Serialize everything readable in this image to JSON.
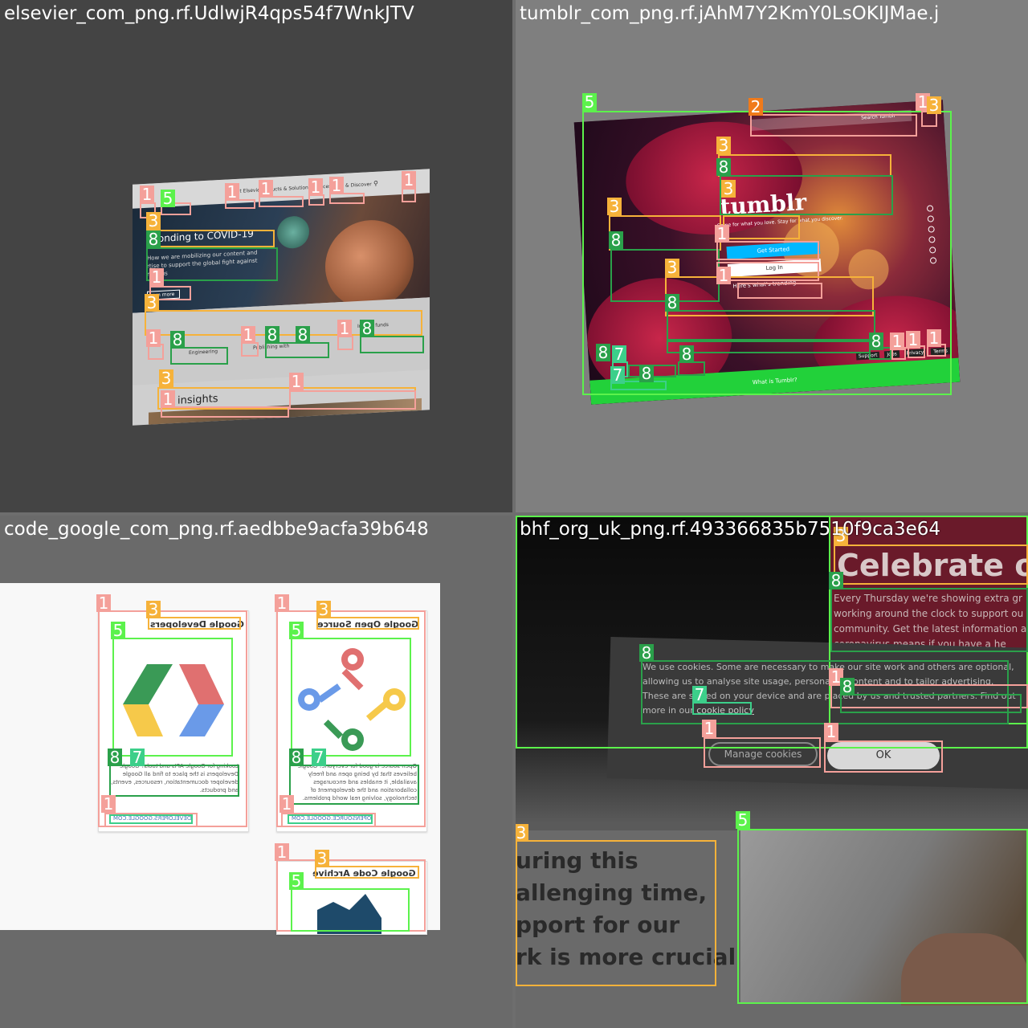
{
  "panels": {
    "q1": {
      "title": "elsevier_com_png.rf.UdlwjR4qps54f7WnkJTV",
      "nav": [
        "About Elsevier",
        "Products & Solutions",
        "Services",
        "Shop & Discover"
      ],
      "hero_heading": "sponding to COVID-19",
      "hero_text": "How we are mobilizing our content and rtise to support the global fight against navirus",
      "hero_button": "arn more",
      "strip_items": [
        "Engineering",
        "Publishing with",
        "Insight funds"
      ],
      "insights": "in insights"
    },
    "q2": {
      "title": "tumblr_com_png.rf.jAhM7Y2KmY0LsOKIJMae.j",
      "search_placeholder": "Search Tumblr",
      "logo": "tumblr",
      "tagline": "Come for what you love. Stay for what you discover.",
      "get_started": "Get Started",
      "log_in": "Log In",
      "trending": "Here's what's trending",
      "footer_links": [
        "Support",
        "Jobs",
        "Privacy",
        "Terms"
      ],
      "footer_bar": "What is Tumblr?"
    },
    "q3": {
      "title": "code_google_com_png.rf.aedbbe9acfa39b648",
      "cards": [
        {
          "title": "Google Developers",
          "desc": "Looking for Google APIs and tools? Google Developers is the place to find all Google developer documentation, resources, events, and products.",
          "link": "DEVELOPERS.GOOGLE.COM"
        },
        {
          "title": "Google Open Source",
          "desc": "Open source is good for everyone! Google believes that by being open and freely available, it enables and encourages collaboration and the development of technology, solving real world problems.",
          "link": "OPENSOURCE.GOOGLE.COM"
        },
        {
          "title": "Google Code Archive",
          "desc": "",
          "link": ""
        }
      ]
    },
    "q4": {
      "title": "bhf_org_uk_png.rf.493366835b7510f9ca3e64",
      "celebrate": "Celebrate ou",
      "side_text": "Every Thursday we're showing extra gr working around the clock to support ou community. Get the latest information a 19 coronavirus means if you have a he",
      "cookie_text": "We use cookies. Some are necessary to make our site work and others are optional, allowing us to analyse site usage, personalise content and to tailor advertising. These are stored on your device and are placed by us and trusted partners. Find out more in our",
      "cookie_link": "cookie policy",
      "manage_button": "Manage cookies",
      "ok_button": "OK",
      "big_lines": [
        "uring this",
        "allenging time,",
        "pport for our",
        "rk is more crucial"
      ]
    }
  },
  "labels": {
    "l1": "1",
    "l2": "2",
    "l3": "3",
    "l5": "5",
    "l7": "7",
    "l8": "8"
  },
  "colors": {
    "class1": "#f4a09a",
    "class2": "#f07a1a",
    "class3": "#f6b23a",
    "class5": "#5cf24c",
    "class7": "#3ccf8a",
    "class8": "#2aa04a"
  }
}
